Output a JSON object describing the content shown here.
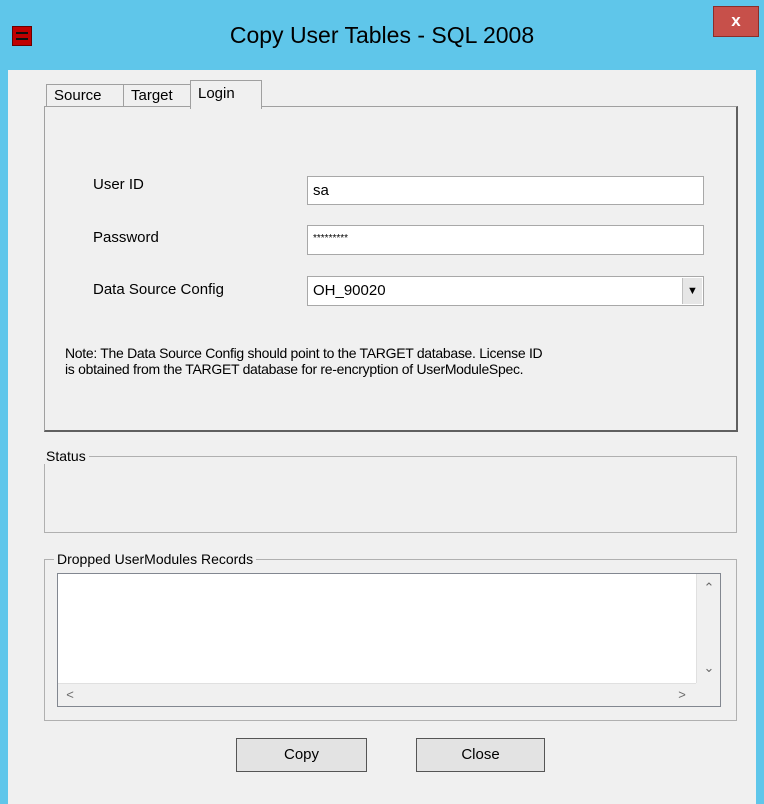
{
  "window": {
    "title": "Copy User Tables - SQL 2008",
    "close_glyph": "x"
  },
  "tabs": [
    {
      "label": "Source"
    },
    {
      "label": "Target"
    },
    {
      "label": "Login"
    }
  ],
  "login": {
    "user_id_label": "User ID",
    "user_id_value": "sa",
    "password_label": "Password",
    "password_value": "*********",
    "dsn_label": "Data Source Config",
    "dsn_value": "OH_90020",
    "note_line1": "Note:  The Data Source Config should point to the TARGET database.  License ID",
    "note_line2": "is obtained from the TARGET database for re-encryption of UserModuleSpec."
  },
  "status_group": {
    "title": "Status"
  },
  "dropped_group": {
    "title": "Dropped UserModules Records"
  },
  "buttons": {
    "copy": "Copy",
    "close": "Close"
  },
  "icons": {
    "combo_arrow": "▼",
    "scroll_up": "⌃",
    "scroll_down": "⌄",
    "scroll_left": "<",
    "scroll_right": ">"
  },
  "colors": {
    "titlebar": "#5fc6ea",
    "close_button": "#c7504a",
    "app_icon": "#c00000"
  }
}
